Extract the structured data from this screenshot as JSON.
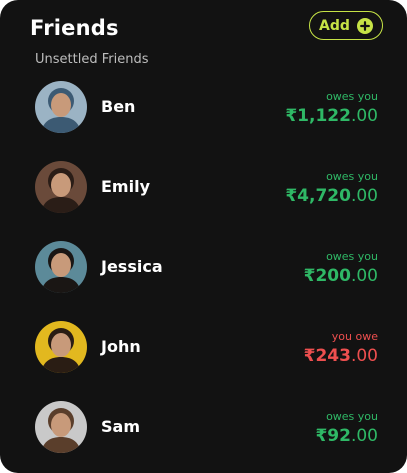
{
  "header": {
    "title": "Friends",
    "add_label": "Add",
    "add_icon": "plus-circle-icon"
  },
  "subheading": "Unsettled Friends",
  "colors": {
    "accent": "#c6e346",
    "owes_you": "#2fb866",
    "you_owe": "#ee4f4f",
    "background": "#121212"
  },
  "friends": [
    {
      "name": "Ben",
      "status": "owes you",
      "currency": "₹",
      "amount_whole": "1,122",
      "amount_decimal": ".00",
      "direction": "owes_you",
      "avatar_bg": "#9bb3c4",
      "avatar_top": "#3c5a73"
    },
    {
      "name": "Emily",
      "status": "owes you",
      "currency": "₹",
      "amount_whole": "4,720",
      "amount_decimal": ".00",
      "direction": "owes_you",
      "avatar_bg": "#6a4a3a",
      "avatar_top": "#2a1d17"
    },
    {
      "name": "Jessica",
      "status": "owes you",
      "currency": "₹",
      "amount_whole": "200",
      "amount_decimal": ".00",
      "direction": "owes_you",
      "avatar_bg": "#5c8a99",
      "avatar_top": "#1a1614"
    },
    {
      "name": "John",
      "status": "you owe",
      "currency": "₹",
      "amount_whole": "243",
      "amount_decimal": ".00",
      "direction": "you_owe",
      "avatar_bg": "#e2b81f",
      "avatar_top": "#2a1d14"
    },
    {
      "name": "Sam",
      "status": "owes you",
      "currency": "₹",
      "amount_whole": "92",
      "amount_decimal": ".00",
      "direction": "owes_you",
      "avatar_bg": "#c9c9c9",
      "avatar_top": "#5a3e2b"
    }
  ]
}
